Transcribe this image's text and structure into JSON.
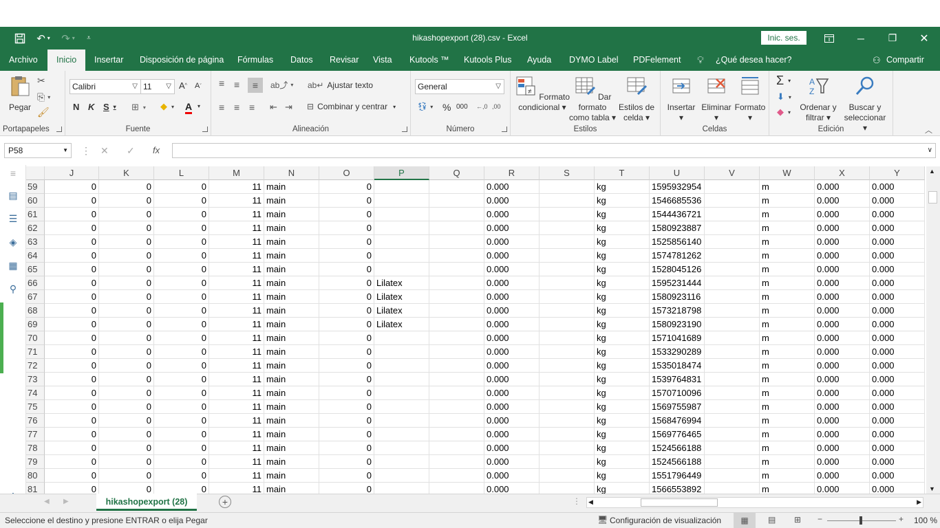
{
  "window": {
    "title": "hikashopexport (28).csv  -  Excel",
    "signin_label": "Inic. ses.",
    "share_label": "Compartir"
  },
  "tabs": [
    "Archivo",
    "Inicio",
    "Insertar",
    "Disposición de página",
    "Fórmulas",
    "Datos",
    "Revisar",
    "Vista",
    "Kutools ™",
    "Kutools Plus",
    "Ayuda",
    "DYMO Label",
    "PDFelement",
    "¿Qué desea hacer?"
  ],
  "ribbon": {
    "portapapeles": {
      "label": "Portapapeles",
      "paste": "Pegar"
    },
    "fuente": {
      "label": "Fuente",
      "font": "Calibri",
      "size": "11"
    },
    "alineacion": {
      "label": "Alineación",
      "wrap": "Ajustar texto",
      "merge": "Combinar y centrar"
    },
    "numero": {
      "label": "Número",
      "format": "General"
    },
    "estilos": {
      "label": "Estilos",
      "cond_1": "Formato",
      "cond_2": "condicional",
      "table_1": "Dar formato",
      "table_2": "como tabla",
      "cell_1": "Estilos de",
      "cell_2": "celda"
    },
    "celdas": {
      "label": "Celdas",
      "insert": "Insertar",
      "delete": "Eliminar",
      "format": "Formato"
    },
    "edicion": {
      "label": "Edición",
      "sort_1": "Ordenar y",
      "sort_2": "filtrar",
      "find_1": "Buscar y",
      "find_2": "seleccionar"
    }
  },
  "formula_bar": {
    "name_box": "P58",
    "formula": ""
  },
  "grid": {
    "columns": [
      "J",
      "K",
      "L",
      "M",
      "N",
      "O",
      "P",
      "Q",
      "R",
      "S",
      "T",
      "U",
      "V",
      "W",
      "X",
      "Y"
    ],
    "selected_column": "P",
    "rows": [
      {
        "n": "59",
        "j": "0",
        "k": "0",
        "l": "0",
        "m": "11",
        "n2": "main",
        "o": "0",
        "p": "",
        "r": "0.000",
        "t": "kg",
        "u": "1595932954",
        "w": "m",
        "x": "0.000",
        "y": "0.000"
      },
      {
        "n": "60",
        "j": "0",
        "k": "0",
        "l": "0",
        "m": "11",
        "n2": "main",
        "o": "0",
        "p": "",
        "r": "0.000",
        "t": "kg",
        "u": "1546685536",
        "w": "m",
        "x": "0.000",
        "y": "0.000"
      },
      {
        "n": "61",
        "j": "0",
        "k": "0",
        "l": "0",
        "m": "11",
        "n2": "main",
        "o": "0",
        "p": "",
        "r": "0.000",
        "t": "kg",
        "u": "1544436721",
        "w": "m",
        "x": "0.000",
        "y": "0.000"
      },
      {
        "n": "62",
        "j": "0",
        "k": "0",
        "l": "0",
        "m": "11",
        "n2": "main",
        "o": "0",
        "p": "",
        "r": "0.000",
        "t": "kg",
        "u": "1580923887",
        "w": "m",
        "x": "0.000",
        "y": "0.000"
      },
      {
        "n": "63",
        "j": "0",
        "k": "0",
        "l": "0",
        "m": "11",
        "n2": "main",
        "o": "0",
        "p": "",
        "r": "0.000",
        "t": "kg",
        "u": "1525856140",
        "w": "m",
        "x": "0.000",
        "y": "0.000"
      },
      {
        "n": "64",
        "j": "0",
        "k": "0",
        "l": "0",
        "m": "11",
        "n2": "main",
        "o": "0",
        "p": "",
        "r": "0.000",
        "t": "kg",
        "u": "1574781262",
        "w": "m",
        "x": "0.000",
        "y": "0.000"
      },
      {
        "n": "65",
        "j": "0",
        "k": "0",
        "l": "0",
        "m": "11",
        "n2": "main",
        "o": "0",
        "p": "",
        "r": "0.000",
        "t": "kg",
        "u": "1528045126",
        "w": "m",
        "x": "0.000",
        "y": "0.000"
      },
      {
        "n": "66",
        "j": "0",
        "k": "0",
        "l": "0",
        "m": "11",
        "n2": "main",
        "o": "0",
        "p": "Lilatex",
        "r": "0.000",
        "t": "kg",
        "u": "1595231444",
        "w": "m",
        "x": "0.000",
        "y": "0.000"
      },
      {
        "n": "67",
        "j": "0",
        "k": "0",
        "l": "0",
        "m": "11",
        "n2": "main",
        "o": "0",
        "p": "Lilatex",
        "r": "0.000",
        "t": "kg",
        "u": "1580923116",
        "w": "m",
        "x": "0.000",
        "y": "0.000"
      },
      {
        "n": "68",
        "j": "0",
        "k": "0",
        "l": "0",
        "m": "11",
        "n2": "main",
        "o": "0",
        "p": "Lilatex",
        "r": "0.000",
        "t": "kg",
        "u": "1573218798",
        "w": "m",
        "x": "0.000",
        "y": "0.000"
      },
      {
        "n": "69",
        "j": "0",
        "k": "0",
        "l": "0",
        "m": "11",
        "n2": "main",
        "o": "0",
        "p": "Lilatex",
        "r": "0.000",
        "t": "kg",
        "u": "1580923190",
        "w": "m",
        "x": "0.000",
        "y": "0.000"
      },
      {
        "n": "70",
        "j": "0",
        "k": "0",
        "l": "0",
        "m": "11",
        "n2": "main",
        "o": "0",
        "p": "",
        "r": "0.000",
        "t": "kg",
        "u": "1571041689",
        "w": "m",
        "x": "0.000",
        "y": "0.000"
      },
      {
        "n": "71",
        "j": "0",
        "k": "0",
        "l": "0",
        "m": "11",
        "n2": "main",
        "o": "0",
        "p": "",
        "r": "0.000",
        "t": "kg",
        "u": "1533290289",
        "w": "m",
        "x": "0.000",
        "y": "0.000"
      },
      {
        "n": "72",
        "j": "0",
        "k": "0",
        "l": "0",
        "m": "11",
        "n2": "main",
        "o": "0",
        "p": "",
        "r": "0.000",
        "t": "kg",
        "u": "1535018474",
        "w": "m",
        "x": "0.000",
        "y": "0.000"
      },
      {
        "n": "73",
        "j": "0",
        "k": "0",
        "l": "0",
        "m": "11",
        "n2": "main",
        "o": "0",
        "p": "",
        "r": "0.000",
        "t": "kg",
        "u": "1539764831",
        "w": "m",
        "x": "0.000",
        "y": "0.000"
      },
      {
        "n": "74",
        "j": "0",
        "k": "0",
        "l": "0",
        "m": "11",
        "n2": "main",
        "o": "0",
        "p": "",
        "r": "0.000",
        "t": "kg",
        "u": "1570710096",
        "w": "m",
        "x": "0.000",
        "y": "0.000"
      },
      {
        "n": "75",
        "j": "0",
        "k": "0",
        "l": "0",
        "m": "11",
        "n2": "main",
        "o": "0",
        "p": "",
        "r": "0.000",
        "t": "kg",
        "u": "1569755987",
        "w": "m",
        "x": "0.000",
        "y": "0.000"
      },
      {
        "n": "76",
        "j": "0",
        "k": "0",
        "l": "0",
        "m": "11",
        "n2": "main",
        "o": "0",
        "p": "",
        "r": "0.000",
        "t": "kg",
        "u": "1568476994",
        "w": "m",
        "x": "0.000",
        "y": "0.000"
      },
      {
        "n": "77",
        "j": "0",
        "k": "0",
        "l": "0",
        "m": "11",
        "n2": "main",
        "o": "0",
        "p": "",
        "r": "0.000",
        "t": "kg",
        "u": "1569776465",
        "w": "m",
        "x": "0.000",
        "y": "0.000"
      },
      {
        "n": "78",
        "j": "0",
        "k": "0",
        "l": "0",
        "m": "11",
        "n2": "main",
        "o": "0",
        "p": "",
        "r": "0.000",
        "t": "kg",
        "u": "1524566188",
        "w": "m",
        "x": "0.000",
        "y": "0.000"
      },
      {
        "n": "79",
        "j": "0",
        "k": "0",
        "l": "0",
        "m": "11",
        "n2": "main",
        "o": "0",
        "p": "",
        "r": "0.000",
        "t": "kg",
        "u": "1524566188",
        "w": "m",
        "x": "0.000",
        "y": "0.000"
      },
      {
        "n": "80",
        "j": "0",
        "k": "0",
        "l": "0",
        "m": "11",
        "n2": "main",
        "o": "0",
        "p": "",
        "r": "0.000",
        "t": "kg",
        "u": "1551796449",
        "w": "m",
        "x": "0.000",
        "y": "0.000"
      },
      {
        "n": "81",
        "j": "0",
        "k": "0",
        "l": "0",
        "m": "11",
        "n2": "main",
        "o": "0",
        "p": "",
        "r": "0.000",
        "t": "kg",
        "u": "1566553892",
        "w": "m",
        "x": "0.000",
        "y": "0.000"
      }
    ]
  },
  "sheet_tab": "hikashopexport (28)",
  "status": {
    "message": "Seleccione el destino y presione ENTRAR o elija Pegar",
    "display_settings": "Configuración de visualización",
    "zoom": "100 %"
  },
  "colors": {
    "excel_green": "#217346",
    "ribbon_bg": "#f3f3f3"
  }
}
